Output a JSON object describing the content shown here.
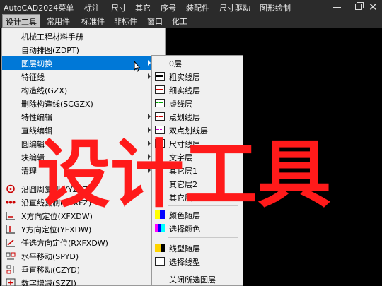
{
  "app_title": "AutoCAD2024菜单",
  "top_menu": [
    "标注",
    "尺寸",
    "其它",
    "序号",
    "装配件",
    "尺寸驱动",
    "图形绘制"
  ],
  "second_menu": [
    "设计工具",
    "常用件",
    "标准件",
    "非标件",
    "窗口",
    "化工"
  ],
  "design_tools_menu": {
    "items": [
      "机械工程材料手册",
      "自动排图(ZDPT)",
      "图层切换",
      "特征线",
      "构造线(GZX)",
      "删除构造线(SCGZX)",
      "特性编辑",
      "直线编辑",
      "圆编辑",
      "块编辑",
      "清理",
      "沿圆周复制(YYZFZ)",
      "沿直线复制(YZXFZ)",
      "X方向定位(XFXDW)",
      "Y方向定位(YFXDW)",
      "任选方向定位(RXFXDW)",
      "水平移动(SPYD)",
      "垂直移动(CZYD)",
      "数字增减(SZZJ)"
    ]
  },
  "layer_submenu": {
    "items": [
      "0层",
      "粗实线层",
      "细实线层",
      "虚线层",
      "点划线层",
      "双点划线层",
      "尺寸线层",
      "文字层",
      "其它层1",
      "其它层2",
      "其它层3",
      "颜色随层",
      "选择颜色",
      "线型随层",
      "选择线型",
      "关闭所选图层"
    ]
  },
  "overlay_text": "设计工具",
  "colors": {
    "highlight": "#0078d7",
    "overlay": "#ff1a1a",
    "menu_bg": "#f0f0f0",
    "bar_bg": "#2b2b2b"
  }
}
